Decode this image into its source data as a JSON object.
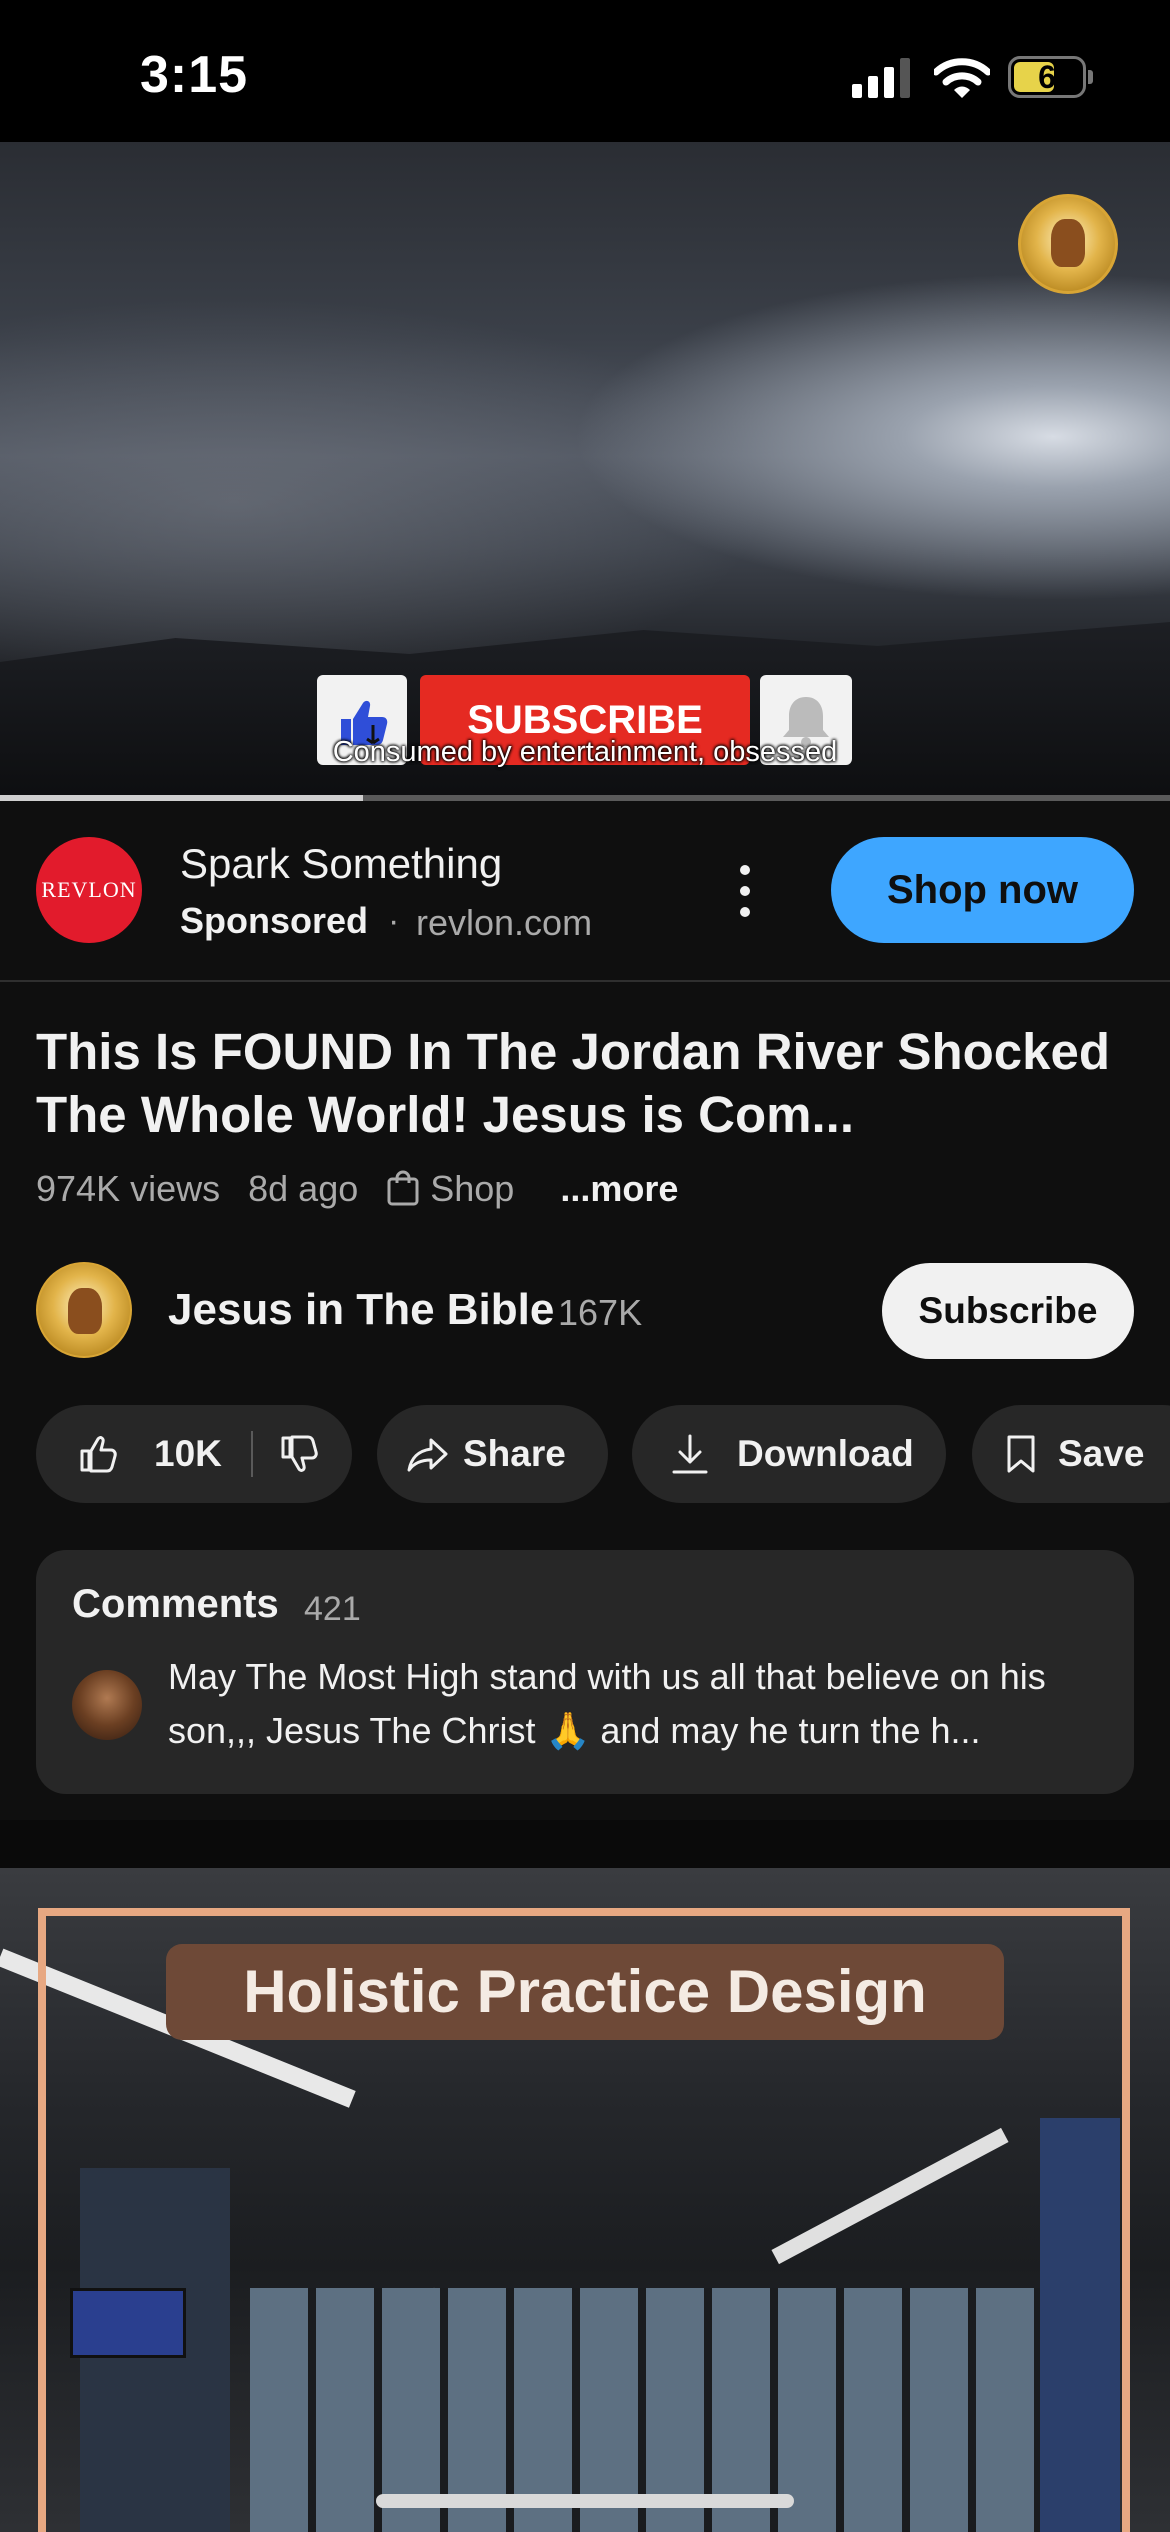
{
  "status_bar": {
    "time": "3:15",
    "battery": "6"
  },
  "player": {
    "overlay_subscribe": "SUBSCRIBE",
    "caption": "Consumed by entertainment, obsessed",
    "progress": 0.31
  },
  "ad": {
    "logo_text": "REVLON",
    "title": "Spark Something",
    "sponsored": "Sponsored",
    "separator": "·",
    "domain": "revlon.com",
    "cta": "Shop now"
  },
  "video": {
    "title": "This Is FOUND In The Jordan River Shocked The Whole World! Jesus is Com...",
    "views": "974K views",
    "age": "8d ago",
    "shop": "Shop",
    "more": "...more"
  },
  "channel": {
    "name": "Jesus in The Bible",
    "subscribers": "167K",
    "subscribe_label": "Subscribe"
  },
  "actions": {
    "likes": "10K",
    "share": "Share",
    "download": "Download",
    "save": "Save"
  },
  "comments": {
    "title": "Comments",
    "count": "421",
    "top_comment": "May The Most High stand with us all that believe on his son,,, Jesus The Christ 🙏 and may he turn the h..."
  },
  "next_video": {
    "banner": "Holistic Practice Design"
  }
}
